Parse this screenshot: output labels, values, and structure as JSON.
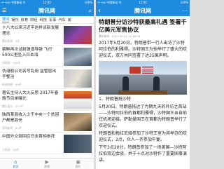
{
  "left": {
    "status": {
      "carrier": "•••oo 中国移动 令",
      "time": "12:00",
      "battery": "100%"
    },
    "nav": {
      "title": "腾讯网",
      "menu_icon": "menu-icon",
      "search_icon": "search-icon"
    },
    "categories": [
      "要闻",
      "娱乐",
      "体育",
      "财经",
      "科技",
      "军事",
      "汽车",
      "房"
    ],
    "feed": [
      {
        "title": "十八大以来习近平这样谈新发展理念",
        "meta": "腾讯新闻 · 2评",
        "thumb": "th1"
      },
      {
        "title": "朝鲜再次试射弹道导弹 飞行500公里坠入日本海",
        "meta": "环球网 · 128评",
        "thumb": "th2"
      },
      {
        "title": "伪港股公司名号乱用 监管层出手整治",
        "meta": "新浪财经 · 45评",
        "thumb": "th3"
      },
      {
        "title": "著名主持人大火反思 2017年春晚节目单曝光",
        "meta": "腾讯娱乐 · 302评",
        "thumb": "th4"
      },
      {
        "title": "陕西某县收入少于中央一个贫困户都是县长",
        "meta": "澎湃新闻 · 61评",
        "thumb": "th5"
      },
      {
        "title": "中国外交部回应日本首相参拜",
        "meta": "人民网 · 18评",
        "thumb": "th6"
      }
    ],
    "tabs": [
      {
        "label": "首页",
        "icon": "home-icon",
        "glyph": "⌂"
      },
      {
        "label": "视频",
        "icon": "video-icon",
        "glyph": "▶"
      },
      {
        "label": "图片",
        "icon": "image-icon",
        "glyph": "▣"
      }
    ]
  },
  "right": {
    "status": {
      "carrier": "•••oo 中国移动 令",
      "time": "12:00",
      "battery": "100%"
    },
    "nav": {
      "title": "腾讯网",
      "back_glyph": "‹",
      "share_glyph": "⋯"
    },
    "article": {
      "title": "特朗普分访沙特获最高礼遇 签署千亿美元军售协议",
      "meta": "腾讯新闻 · 2017-05-21 11:46:18",
      "p1": "2017年5月20日，特朗普带一行人出访了沙特阿拉伯的利雅得。沙特国王为他举行了盛大的欢迎仪式，双方共同签署了达35国声明。",
      "p2": "1、特朗普抵沙特",
      "p3": "5月20日，特朗普抵达了为期九天的外访之首站——沙特阿拉伯的首都利雅得，沙特国王亲自前往机场迎接。萨勒曼国王在首都为特朗普举行了欢迎仪式。",
      "p4": "特朗普和梅拉尼娅参加了沙特王室为其举办的欢迎仪式，2点，众人一齐参加午宴。",
      "p5": "下午3点20分，特朗普参加了一场美国—沙特阿拉伯双边会谈，并于十点对沙特作了重要国事演讲。"
    }
  },
  "colors": {
    "brand": "#1d8be0"
  }
}
